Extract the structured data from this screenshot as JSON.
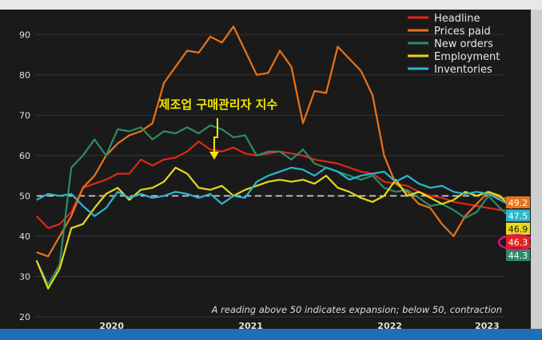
{
  "chart_data": {
    "type": "line",
    "title": "",
    "xlabel": "",
    "ylabel": "",
    "ylim": [
      20,
      95
    ],
    "y_ticks": [
      20,
      30,
      40,
      50,
      60,
      70,
      80,
      90
    ],
    "x_ticks": [
      {
        "label": "2020",
        "x": 2020.5
      },
      {
        "label": "2021",
        "x": 2021.5
      },
      {
        "label": "2022",
        "x": 2022.5
      },
      {
        "label": "2023",
        "x": 2023.2
      }
    ],
    "x_range": [
      2019.95,
      2023.33
    ],
    "reference_line": 50,
    "grid": true,
    "legend_position": "top-right",
    "annotation": "제조업 구매관리자 지수",
    "footnote": "A reading above 50 indicates expansion; below 50, contraction",
    "x_start": 2019.96,
    "x_step": 0.0833,
    "series": [
      {
        "name": "Headline",
        "color": "#e0261c",
        "values": [
          45,
          42,
          43,
          46,
          52,
          53,
          54,
          55.5,
          55.5,
          59,
          57.5,
          59,
          59.5,
          61,
          63.5,
          61.5,
          61,
          62,
          60.5,
          60,
          60.5,
          61,
          60.5,
          60,
          59,
          58.5,
          58,
          57,
          56,
          55.5,
          53.5,
          53,
          52.5,
          51,
          50,
          49.5,
          48.5,
          48,
          47.5,
          47,
          46.5,
          46.3
        ],
        "last_label": "46.3"
      },
      {
        "name": "Prices paid",
        "color": "#e8731a",
        "values": [
          36,
          35,
          40,
          45,
          52,
          55,
          60,
          63,
          65,
          66,
          68,
          78,
          82,
          86,
          85.5,
          89.5,
          88,
          92,
          86,
          80,
          80.5,
          86,
          82,
          68,
          76,
          75.5,
          87,
          84,
          81,
          75,
          60,
          53,
          51,
          48,
          47,
          43,
          40,
          45,
          48,
          51,
          49.5,
          49.2
        ],
        "last_label": "49.2"
      },
      {
        "name": "New orders",
        "color": "#2d8b68",
        "values": [
          34,
          28,
          33,
          57,
          60,
          64,
          60,
          66.5,
          66,
          67,
          64,
          66,
          65.5,
          67,
          65.5,
          67.5,
          66.5,
          64.5,
          65,
          60,
          61,
          61,
          59,
          61.5,
          58,
          57,
          56,
          55,
          54,
          55,
          52,
          51,
          51.5,
          49.5,
          47.5,
          48,
          46.5,
          44.5,
          46,
          50,
          47,
          44.3
        ],
        "last_label": "44.3"
      },
      {
        "name": "Employment",
        "color": "#e6d81b",
        "values": [
          34,
          27,
          32,
          42,
          43,
          47,
          50.5,
          52,
          49,
          51.5,
          52,
          53.5,
          57,
          55.5,
          52,
          51.5,
          52.5,
          50,
          51.5,
          52.5,
          53.5,
          54,
          53.5,
          54,
          53,
          55,
          52,
          51,
          49.5,
          48.5,
          50,
          54,
          50,
          51,
          49.5,
          48,
          49,
          51,
          50,
          51,
          50,
          46.9
        ],
        "last_label": "46.9"
      },
      {
        "name": "Inventories",
        "color": "#2bb7d0",
        "values": [
          49,
          50.5,
          50,
          50.5,
          47.5,
          45,
          47,
          51,
          49.5,
          50.5,
          49.5,
          50,
          51,
          50.5,
          49.5,
          50.5,
          48,
          50,
          49.5,
          53.5,
          55,
          56,
          57,
          56.5,
          55,
          57,
          56,
          54,
          55,
          55.5,
          56,
          53.5,
          55,
          53,
          52,
          52.5,
          51,
          50.5,
          51,
          50.5,
          49,
          47.5
        ],
        "last_label": "47.5"
      }
    ]
  }
}
